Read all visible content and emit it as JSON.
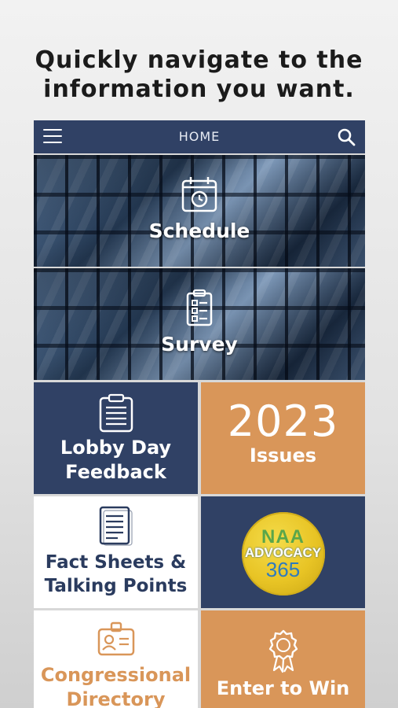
{
  "headline": {
    "line1": "Quickly navigate to the",
    "line2": "information you want."
  },
  "navbar": {
    "title": "HOME",
    "menu_icon": "hamburger-menu-icon",
    "search_icon": "search-icon"
  },
  "banners": [
    {
      "label": "Schedule",
      "icon": "calendar-clock-icon"
    },
    {
      "label": "Survey",
      "icon": "checklist-icon"
    }
  ],
  "tiles": {
    "lobby": {
      "line1": "Lobby Day",
      "line2": "Feedback",
      "icon": "clipboard-icon"
    },
    "issues": {
      "year": "2023",
      "label": "Issues"
    },
    "fact": {
      "line1": "Fact Sheets &",
      "line2": "Talking Points",
      "icon": "document-icon"
    },
    "advocacy": {
      "logo_top": "NAA",
      "logo_mid": "ADVOCACY",
      "logo_num": "365"
    },
    "congress": {
      "line1": "Congressional",
      "line2": "Directory",
      "icon": "id-badge-icon"
    },
    "win": {
      "label": "Enter to Win",
      "icon": "award-ribbon-icon"
    }
  },
  "colors": {
    "navy": "#304165",
    "orange": "#d99659",
    "white": "#ffffff",
    "text_navy": "#2a3b5e"
  }
}
